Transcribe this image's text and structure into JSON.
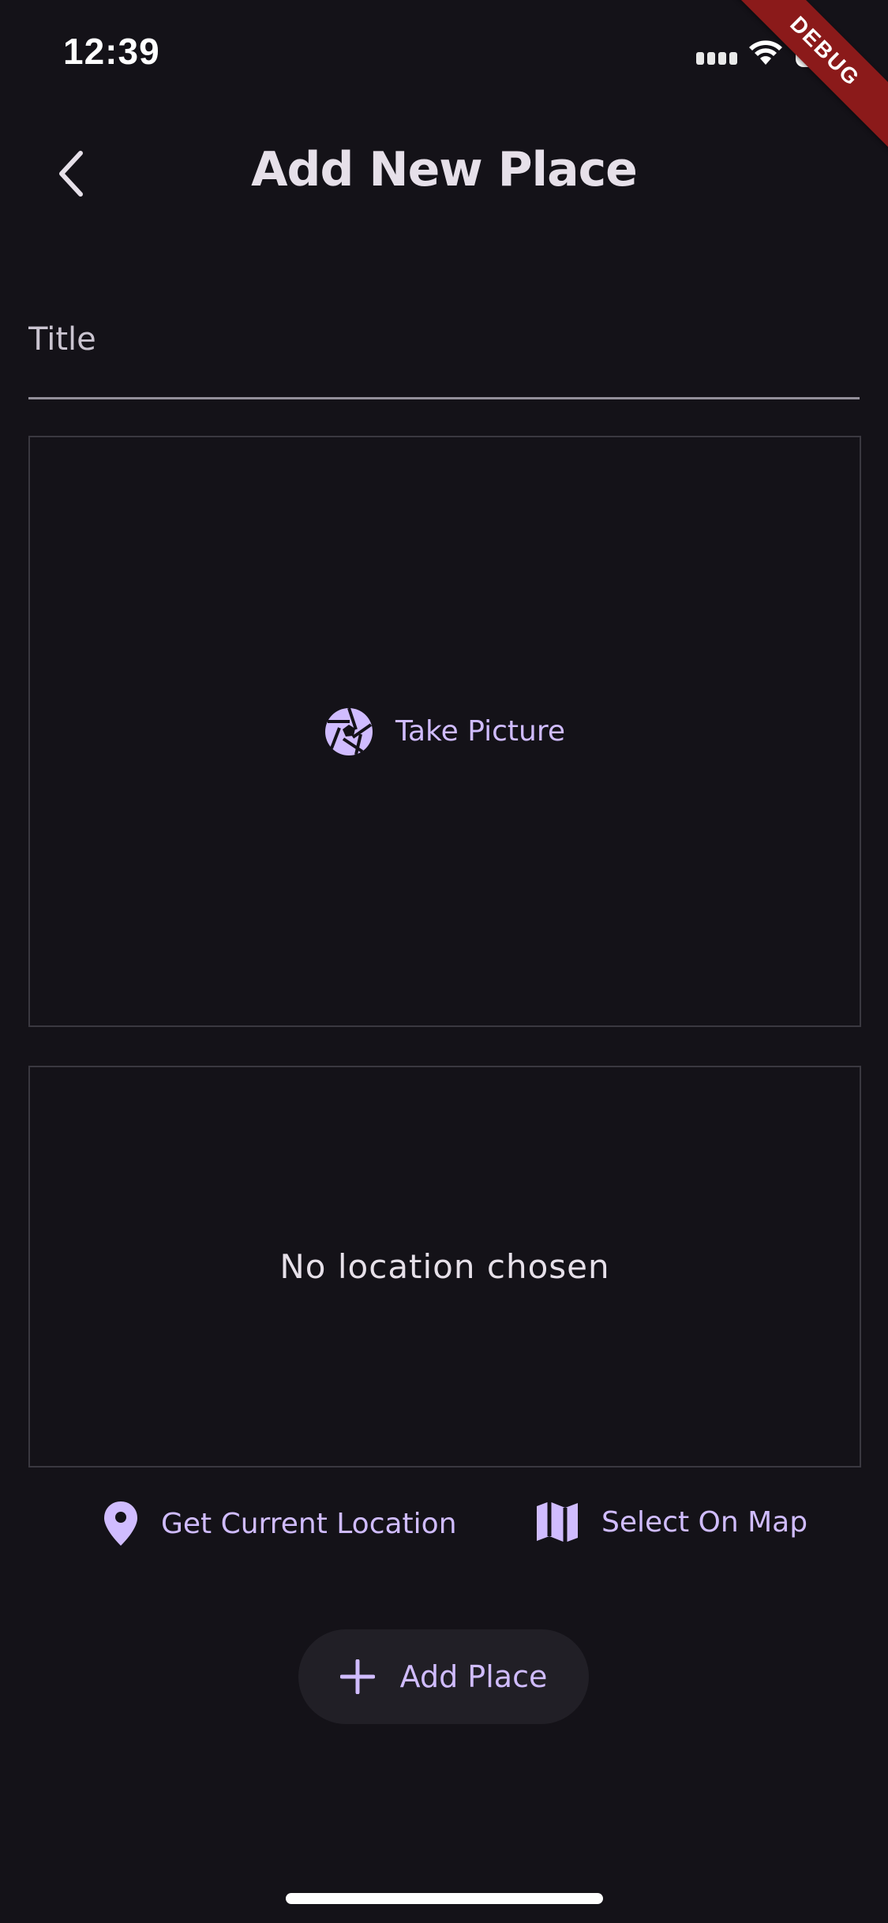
{
  "status_bar": {
    "time": "12:39",
    "battery_level": "96",
    "debug_label": "DEBUG"
  },
  "app_bar": {
    "back_icon": "chevron-left-icon",
    "title": "Add New Place"
  },
  "form": {
    "title_field": {
      "placeholder": "Title",
      "value": ""
    },
    "image_picker": {
      "button_icon": "camera-aperture-icon",
      "button_label": "Take Picture"
    },
    "location_picker": {
      "empty_text": "No location chosen",
      "get_current_icon": "location-pin-icon",
      "get_current_label": "Get Current Location",
      "select_map_icon": "map-icon",
      "select_map_label": "Select On Map"
    },
    "submit": {
      "icon": "plus-icon",
      "label": "Add Place"
    }
  },
  "colors": {
    "background": "#141218",
    "accent": "#d0bcff",
    "text": "#e6e0e9",
    "debug_banner": "#8b1a1a"
  }
}
